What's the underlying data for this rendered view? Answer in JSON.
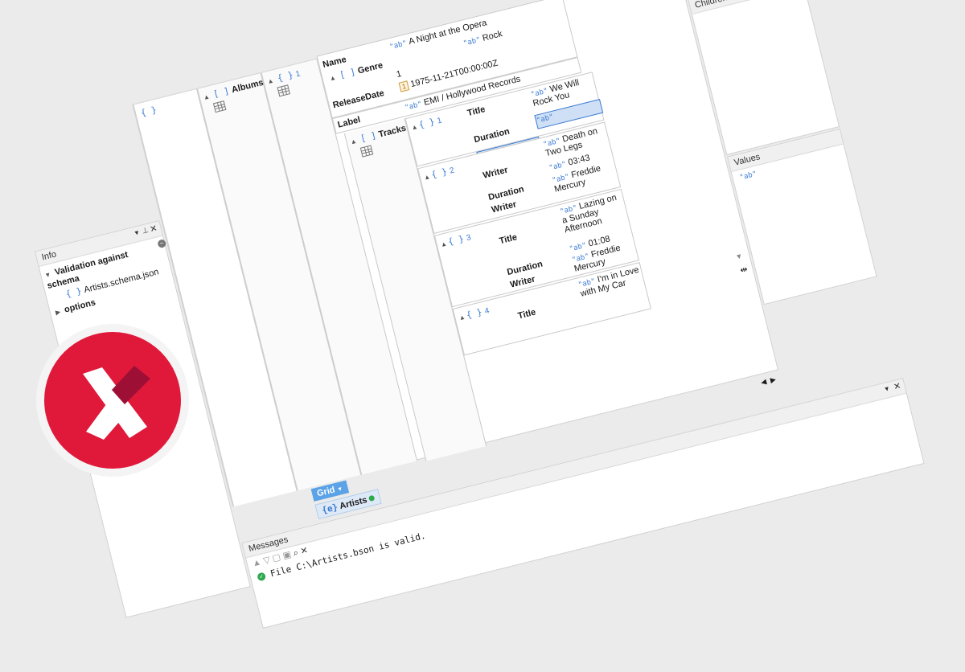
{
  "info": {
    "header": "Info",
    "validation_label": "Validation against schema",
    "schema_file": "Artists.schema.json",
    "options_label": "options"
  },
  "tree": {
    "root_brace": "{ }",
    "albums_label": "Albums",
    "album_index": "1",
    "name_label": "Name",
    "name_value": "A Night at the Opera",
    "genre_label": "Genre",
    "genre_value": "Rock",
    "genre_index": "1",
    "release_label": "ReleaseDate",
    "release_value": "1975-11-21T00:00:00Z",
    "label_label": "Label",
    "label_value": "EMI / Hollywood Records",
    "tracks_label": "Tracks",
    "date_badge": "1"
  },
  "tracks": [
    {
      "index": "1",
      "title_label": "Title",
      "title": "We Will Rock You",
      "duration_label": "Duration",
      "duration": "",
      "writer_label": "Writer",
      "writer": ""
    },
    {
      "index": "2",
      "title_label": "Title",
      "title": "Death on Two Legs",
      "duration_label": "Duration",
      "duration": "03:43",
      "writer_label": "Writer",
      "writer": "Freddie Mercury"
    },
    {
      "index": "3",
      "title_label": "Title",
      "title": "Lazing on a Sunday Afternoon",
      "duration_label": "Duration",
      "duration": "01:08",
      "writer_label": "Writer",
      "writer": "Freddie Mercury"
    },
    {
      "index": "4",
      "title_label": "Title",
      "title": "I'm in Love with My Car"
    }
  ],
  "drag": {
    "label": "Duration"
  },
  "right": {
    "children_header": "Children",
    "values_header": "Values"
  },
  "bottom": {
    "grid_button": "Grid",
    "doc_tab": "Artists",
    "messages_header": "Messages",
    "message_text": "File C:\\Artists.bson is valid."
  },
  "colors": {
    "accent": "#3b7bd4",
    "logo": "#e0193a",
    "logo_dark": "#9e0f36",
    "ok": "#2fa84f"
  }
}
